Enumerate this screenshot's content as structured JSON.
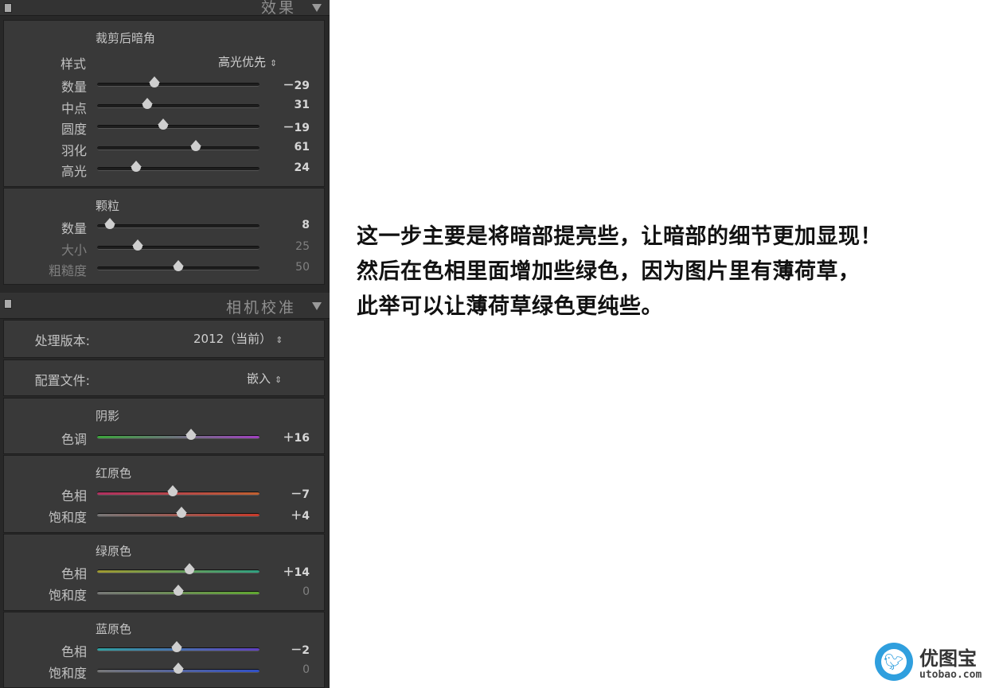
{
  "effects": {
    "header": "效果",
    "vignette": {
      "title": "裁剪后暗角",
      "style_label": "样式",
      "style_value": "高光优先",
      "sliders": [
        {
          "label": "数量",
          "value": "－29",
          "pos": -29,
          "min": -100,
          "max": 100
        },
        {
          "label": "中点",
          "value": "31",
          "pos": 31,
          "min": 0,
          "max": 100
        },
        {
          "label": "圆度",
          "value": "－19",
          "pos": -19,
          "min": -100,
          "max": 100
        },
        {
          "label": "羽化",
          "value": "61",
          "pos": 61,
          "min": 0,
          "max": 100
        },
        {
          "label": "高光",
          "value": "24",
          "pos": 24,
          "min": 0,
          "max": 100
        }
      ]
    },
    "grain": {
      "title": "颗粒",
      "sliders": [
        {
          "label": "数量",
          "value": "8",
          "pos": 8,
          "min": 0,
          "max": 100
        },
        {
          "label": "大小",
          "value": "25",
          "pos": 25,
          "min": 0,
          "max": 100
        },
        {
          "label": "粗糙度",
          "value": "50",
          "pos": 50,
          "min": 0,
          "max": 100
        }
      ]
    }
  },
  "camera": {
    "header": "相机校准",
    "process_label": "处理版本:",
    "process_value": "2012（当前）",
    "profile_label": "配置文件:",
    "profile_value": "嵌入",
    "shadows": {
      "title": "阴影",
      "sliders": [
        {
          "label": "色调",
          "value": "＋16",
          "pos": 16,
          "min": -100,
          "max": 100
        }
      ]
    },
    "red": {
      "title": "红原色",
      "sliders": [
        {
          "label": "色相",
          "value": "－7",
          "pos": -7,
          "min": -100,
          "max": 100
        },
        {
          "label": "饱和度",
          "value": "＋4",
          "pos": 4,
          "min": -100,
          "max": 100
        }
      ]
    },
    "green": {
      "title": "绿原色",
      "sliders": [
        {
          "label": "色相",
          "value": "＋14",
          "pos": 14,
          "min": -100,
          "max": 100
        },
        {
          "label": "饱和度",
          "value": "0",
          "pos": 0,
          "min": -100,
          "max": 100
        }
      ]
    },
    "blue": {
      "title": "蓝原色",
      "sliders": [
        {
          "label": "色相",
          "value": "－2",
          "pos": -2,
          "min": -100,
          "max": 100
        },
        {
          "label": "饱和度",
          "value": "0",
          "pos": 0,
          "min": -100,
          "max": 100
        }
      ]
    }
  },
  "caption": {
    "line1": "这一步主要是将暗部提亮些，让暗部的细节更加显现！",
    "line2": "然后在色相里面增加些绿色，因为图片里有薄荷草，",
    "line3": "此举可以让薄荷草绿色更纯些。"
  },
  "logo": {
    "name": "优图宝",
    "site": "utobao.com"
  }
}
